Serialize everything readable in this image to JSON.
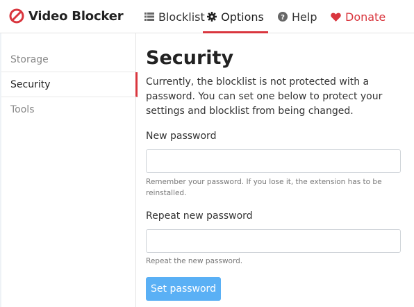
{
  "app": {
    "name": "Video Blocker",
    "icon": "no-entry-icon"
  },
  "nav": {
    "blocklist": {
      "label": "Blocklist",
      "icon": "list-icon"
    },
    "options": {
      "label": "Options",
      "icon": "gear-icon"
    },
    "help": {
      "label": "Help",
      "icon": "question-circle-icon"
    },
    "donate": {
      "label": "Donate",
      "icon": "heart-icon"
    }
  },
  "sidebar": {
    "items": [
      {
        "label": "Storage"
      },
      {
        "label": "Security",
        "active": true
      },
      {
        "label": "Tools"
      }
    ]
  },
  "security": {
    "title": "Security",
    "description": "Currently, the blocklist is not protected with a password. You can set one below to protect your settings and blocklist from being changed.",
    "new_password_label": "New password",
    "new_password_value": "",
    "new_password_help": "Remember your password. If you lose it, the extension has to be reinstalled.",
    "repeat_password_label": "Repeat new password",
    "repeat_password_value": "",
    "repeat_password_help": "Repeat the new password.",
    "submit_label": "Set password"
  },
  "colors": {
    "accent": "#d9363e",
    "button": "#5ab0f5"
  }
}
